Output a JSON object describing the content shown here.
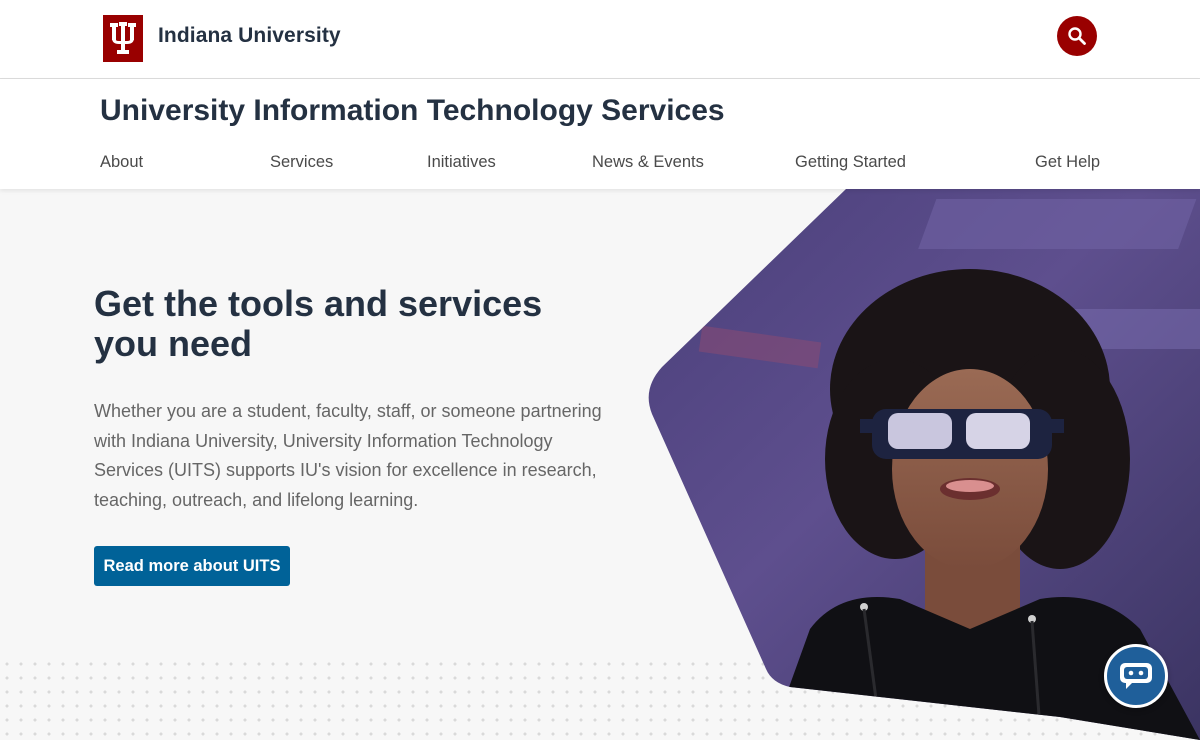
{
  "brand": {
    "name": "Indiana University"
  },
  "site": {
    "title": "University Information Technology Services"
  },
  "nav": [
    {
      "label": "About"
    },
    {
      "label": "Services"
    },
    {
      "label": "Initiatives"
    },
    {
      "label": "News & Events"
    },
    {
      "label": "Getting Started"
    },
    {
      "label": "Get Help"
    }
  ],
  "hero": {
    "title": "Get the tools and services you need",
    "text": "Whether you are a student, faculty, staff, or someone partnering with Indiana University, University Information Technology Services (UITS) supports IU's vision for excellence in research, teaching, outreach, and lifelong learning.",
    "cta": "Read more about UITS"
  },
  "icons": {
    "logo": "iu-trident-logo",
    "search": "search-icon",
    "chat": "chatbot-icon"
  },
  "colors": {
    "brand": "#990000",
    "cta": "#006298",
    "heading": "#243142"
  }
}
